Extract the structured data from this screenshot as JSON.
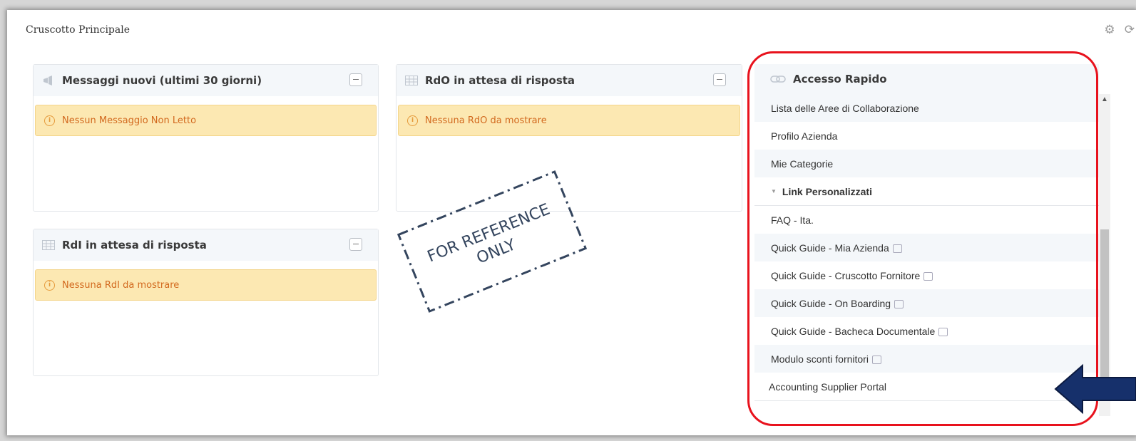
{
  "page": {
    "title": "Cruscotto Principale"
  },
  "top_icons": [
    "gear-icon",
    "refresh-icon"
  ],
  "panels": {
    "messages": {
      "title": "Messaggi nuovi (ultimi 30 giorni)",
      "icon": "megaphone-icon",
      "alert": "Nessun Messaggio Non Letto"
    },
    "rdo": {
      "title": "RdO in attesa di risposta",
      "icon": "table-icon",
      "alert": "Nessuna RdO da mostrare"
    },
    "rdi": {
      "title": "RdI in attesa di risposta",
      "icon": "table-icon",
      "alert": "Nessuna RdI da mostrare"
    }
  },
  "quick_access": {
    "title": "Accesso Rapido",
    "icon": "link-icon",
    "items": [
      "Lista delle Aree di Collaborazione",
      "Profilo Azienda",
      "Mie Categorie"
    ],
    "section": "Link Personalizzati",
    "custom_links": [
      {
        "label": "FAQ - Ita.",
        "external": false
      },
      {
        "label": "Quick Guide - Mia Azienda",
        "external": true
      },
      {
        "label": "Quick Guide - Cruscotto Fornitore",
        "external": true
      },
      {
        "label": "Quick Guide - On Boarding",
        "external": true
      },
      {
        "label": "Quick Guide - Bacheca Documentale",
        "external": true
      },
      {
        "label": "Modulo sconti fornitori",
        "external": true
      }
    ],
    "last_item": "Accounting Supplier Portal"
  },
  "stamp": {
    "line1": "FOR REFERENCE",
    "line2": "ONLY"
  },
  "colors": {
    "highlight_frame": "#e8121d",
    "arrow": "#16306b",
    "alert_bg": "#fce8b2",
    "alert_text": "#d2691e"
  }
}
